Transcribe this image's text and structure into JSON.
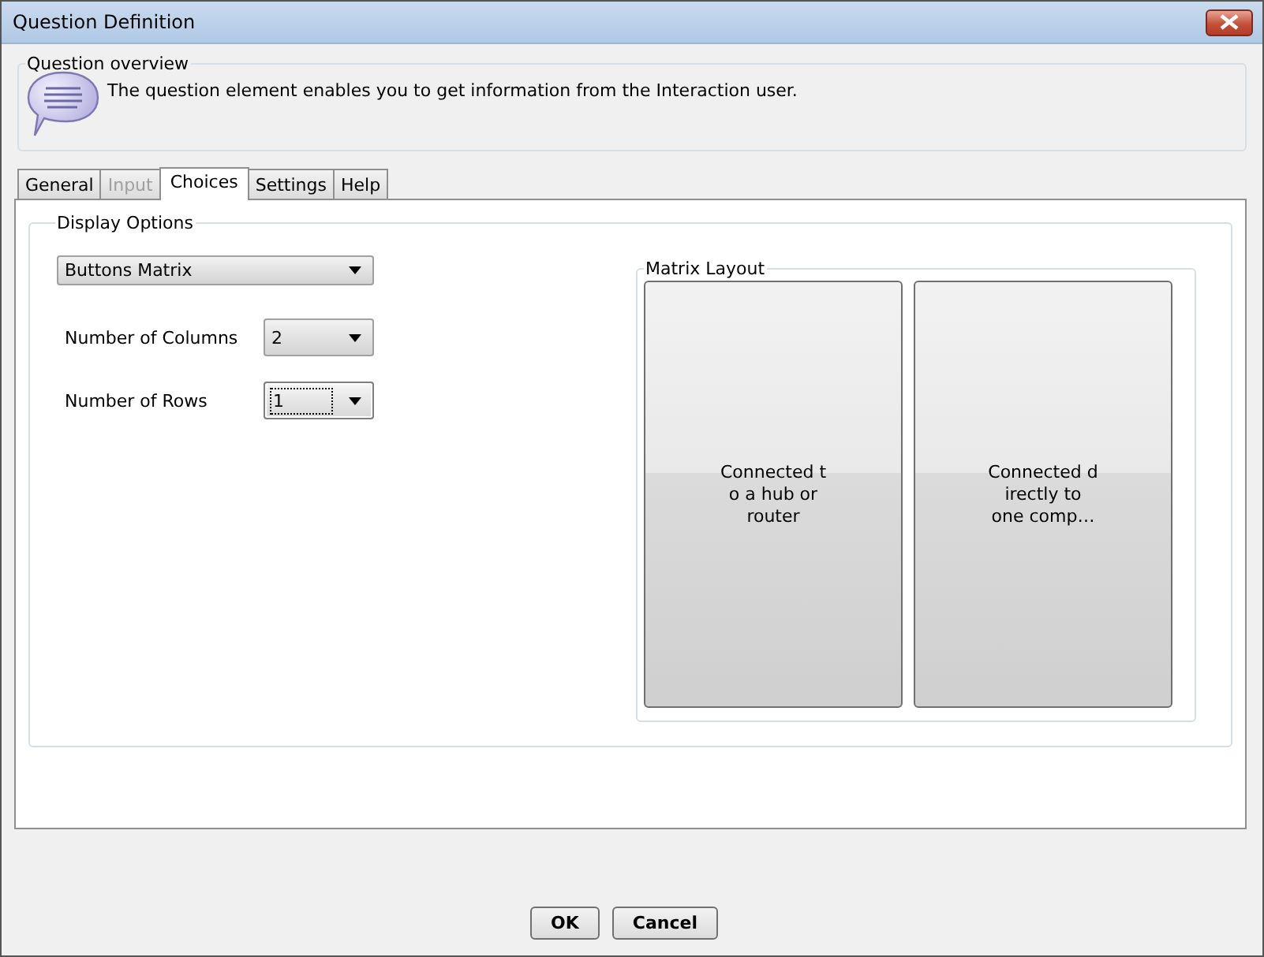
{
  "window": {
    "title": "Question Definition"
  },
  "overview": {
    "legend": "Question overview",
    "description": "The question element enables you to get information from the Interaction user."
  },
  "tabs": [
    {
      "label": "General",
      "selected": false,
      "disabled": false
    },
    {
      "label": "Input",
      "selected": false,
      "disabled": true
    },
    {
      "label": "Choices",
      "selected": true,
      "disabled": false
    },
    {
      "label": "Settings",
      "selected": false,
      "disabled": false
    },
    {
      "label": "Help",
      "selected": false,
      "disabled": false
    }
  ],
  "display_options": {
    "legend": "Display Options",
    "style": {
      "value": "Buttons Matrix"
    },
    "fields": [
      {
        "label": "Number of Columns",
        "value": "2",
        "focused": false
      },
      {
        "label": "Number of Rows",
        "value": "1",
        "focused": true
      }
    ]
  },
  "matrix_layout": {
    "legend": "Matrix Layout",
    "buttons": [
      {
        "lines": [
          "Connected t",
          "o a hub or",
          "router"
        ]
      },
      {
        "lines": [
          "Connected d",
          "irectly to",
          "one comp…"
        ]
      }
    ]
  },
  "buttons": [
    {
      "label": "OK"
    },
    {
      "label": "Cancel"
    }
  ]
}
